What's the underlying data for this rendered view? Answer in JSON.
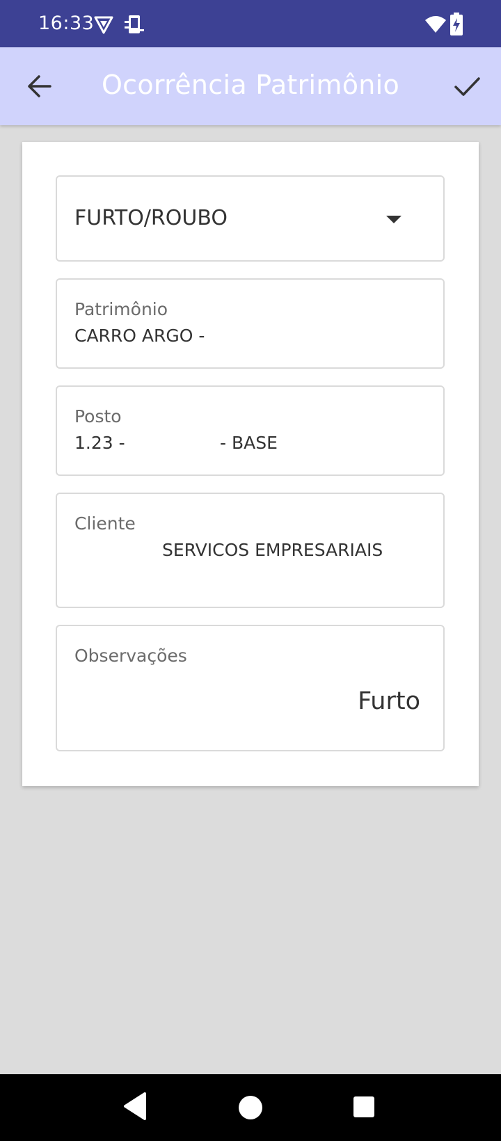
{
  "status_bar": {
    "time": "16:33",
    "icons_left": [
      "vpn-shield-icon",
      "device-icon"
    ],
    "icons_right": [
      "wifi-icon",
      "battery-charging-icon"
    ],
    "background": "#3d4194"
  },
  "app_bar": {
    "title": "Ocorrência Patrimônio",
    "back_icon": "arrow-back-icon",
    "confirm_icon": "check-icon",
    "background": "#d0d3fc"
  },
  "form": {
    "occurrence_type": {
      "selected": "FURTO/ROUBO"
    },
    "patrimonio": {
      "label": "Patrimônio",
      "value": "CARRO ARGO - "
    },
    "posto": {
      "label": "Posto",
      "value_prefix": "1.23 -",
      "value_suffix": "- BASE"
    },
    "cliente": {
      "label": "Cliente",
      "value": "SERVICOS EMPRESARIAIS"
    },
    "observacoes": {
      "label": "Observações",
      "value": "Furto"
    }
  },
  "nav_bar": {
    "buttons": [
      "back-triangle-icon",
      "home-circle-icon",
      "recents-square-icon"
    ]
  }
}
